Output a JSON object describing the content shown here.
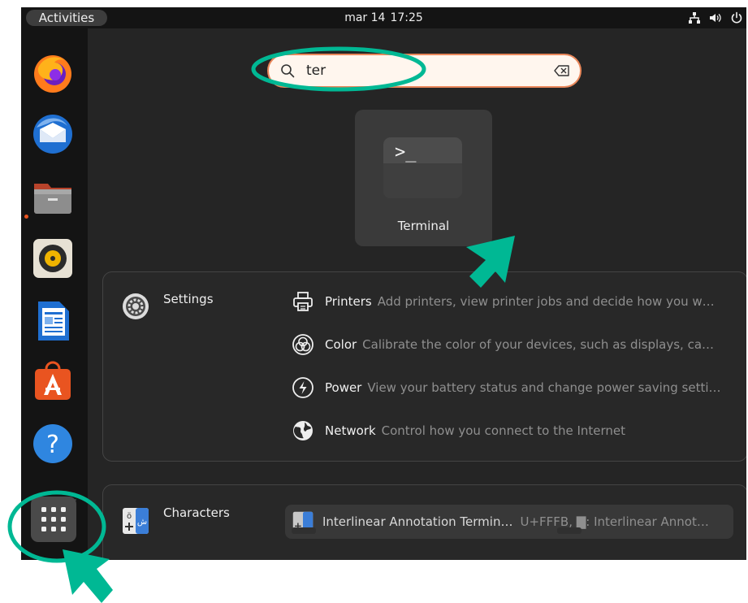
{
  "topbar": {
    "activities_label": "Activities",
    "date": "mar 14",
    "time": "17:25",
    "tray_icons": [
      "network-icon",
      "volume-icon",
      "power-icon"
    ]
  },
  "dock": {
    "apps": [
      "firefox-icon",
      "thunderbird-icon",
      "files-icon",
      "rhythmbox-icon",
      "writer-icon",
      "software-icon",
      "help-icon"
    ],
    "show_apps_icon": "app-grid-icon"
  },
  "search": {
    "value": "ter",
    "search_icon": "search-icon",
    "clear_icon": "backspace-clear-icon"
  },
  "top_result": {
    "label": "Terminal",
    "icon_text": ">_"
  },
  "settings_provider": {
    "name": "Settings",
    "rows": [
      {
        "icon": "printer-icon",
        "name": "Printers",
        "description": "Add printers, view printer jobs and decide how you w…"
      },
      {
        "icon": "color-icon",
        "name": "Color",
        "description": "Calibrate the color of your devices, such as displays, ca…"
      },
      {
        "icon": "power-icon",
        "name": "Power",
        "description": "View your battery status and change power saving setti…"
      },
      {
        "icon": "globe-icon",
        "name": "Network",
        "description": "Control how you connect to the Internet"
      }
    ]
  },
  "characters_provider": {
    "name": "Characters",
    "result": {
      "name": "Interlinear Annotation Termin…",
      "description": "U+FFFB, ▇: Interlinear Annot…"
    }
  },
  "colors": {
    "accent": "#e95420",
    "annotation": "#00b894",
    "background": "#252525"
  }
}
